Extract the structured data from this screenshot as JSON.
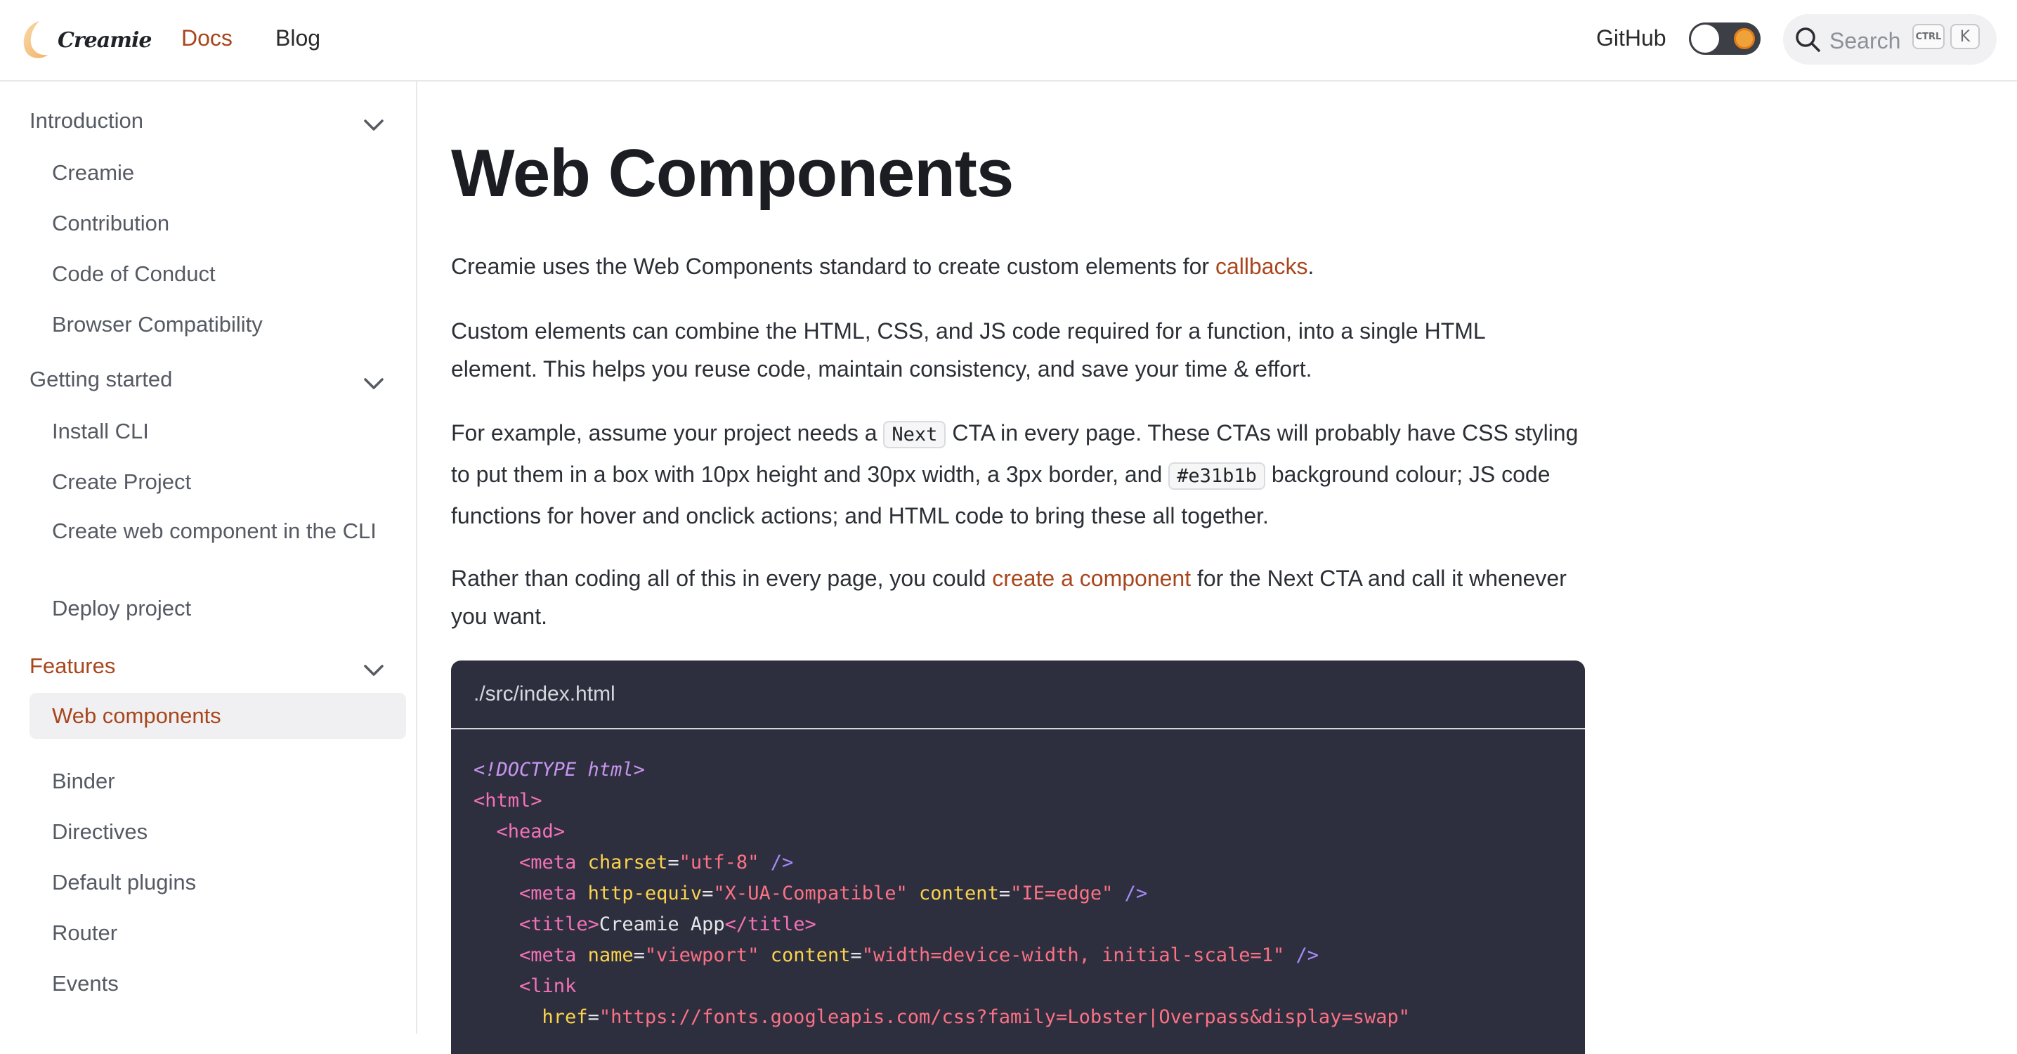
{
  "navbar": {
    "brand": "Creamie",
    "links": {
      "docs": "Docs",
      "blog": "Blog",
      "github": "GitHub"
    },
    "search": {
      "placeholder": "Search",
      "kbd_ctrl": "CTRL",
      "kbd_key": "K"
    },
    "accent_color": "#a8461d"
  },
  "sidebar": {
    "groups": [
      {
        "title": "Introduction",
        "items": [
          "Creamie",
          "Contribution",
          "Code of Conduct",
          "Browser Compatibility"
        ]
      },
      {
        "title": "Getting started",
        "items": [
          "Install CLI",
          "Create Project",
          "Create web component in the CLI",
          "Deploy project"
        ]
      },
      {
        "title": "Features",
        "items": [
          "Web components",
          "Binder",
          "Directives",
          "Default plugins",
          "Router",
          "Events"
        ]
      }
    ],
    "active_group": "Features",
    "active_item": "Web components"
  },
  "main": {
    "title": "Web Components",
    "p1": {
      "before": "Creamie uses the Web Components standard to create custom elements for ",
      "link": "callbacks",
      "after": "."
    },
    "p2": "Custom elements can combine the HTML, CSS, and JS code required for a function, into a single HTML element. This helps you reuse code, maintain consistency, and save your time & effort.",
    "p3": {
      "t1": "For example, assume your project needs a ",
      "code1": "Next",
      "t2": " CTA in every page. These CTAs will probably have CSS styling to put them in a box with 10px height and 30px width, a 3px border, and ",
      "code2": "#e31b1b",
      "t3": " background colour; JS code functions for hover and onclick actions; and HTML code to bring these all together."
    },
    "p4": {
      "before": "Rather than coding all of this in every page, you could ",
      "link": "create a component",
      "after": " for the Next CTA and call it whenever you want."
    },
    "code_block": {
      "filename": "./src/index.html",
      "lines": {
        "l1": "<!DOCTYPE html>",
        "l2_tag": "html",
        "l3_tag": "head",
        "l4": {
          "tag": "meta",
          "a1": "charset",
          "v1": "\"utf-8\""
        },
        "l5": {
          "tag": "meta",
          "a1": "http-equiv",
          "v1": "\"X-UA-Compatible\"",
          "a2": "content",
          "v2": "\"IE=edge\""
        },
        "l6": {
          "tag": "title",
          "text": "Creamie App"
        },
        "l7": {
          "tag": "meta",
          "a1": "name",
          "v1": "\"viewport\"",
          "a2": "content",
          "v2": "\"width=device-width, initial-scale=1\""
        },
        "l8_tag": "link",
        "l9": {
          "a1": "href",
          "v1": "\"https://fonts.googleapis.com/css?family=Lobster|Overpass&display=swap\""
        }
      }
    }
  }
}
